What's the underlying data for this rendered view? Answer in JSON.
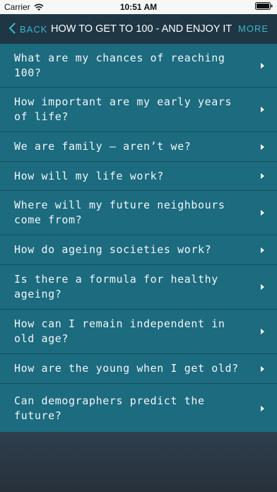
{
  "status_bar": {
    "carrier": "Carrier",
    "time": "10:51 AM",
    "wifi_icon": "wifi-icon",
    "battery_icon": "battery-icon"
  },
  "nav": {
    "back_label": "BACK",
    "title": "HOW TO GET TO 100 - AND ENJOY IT",
    "more_label": "MORE",
    "accent_color": "#38b6c8"
  },
  "questions": [
    "What are my chances of reaching 100?",
    "How important are my early years of life?",
    "We are family – aren’t we?",
    "How will my life work?",
    "Where will my future neighbours come from?",
    "How do ageing societies work?",
    "Is there a formula for healthy ageing?",
    "How can I remain independent in old age?",
    "How are the young when I get old?",
    "Can demographers predict the future?"
  ],
  "colors": {
    "list_background": "#1c6b7f",
    "navbar_background": "#1f3745"
  }
}
